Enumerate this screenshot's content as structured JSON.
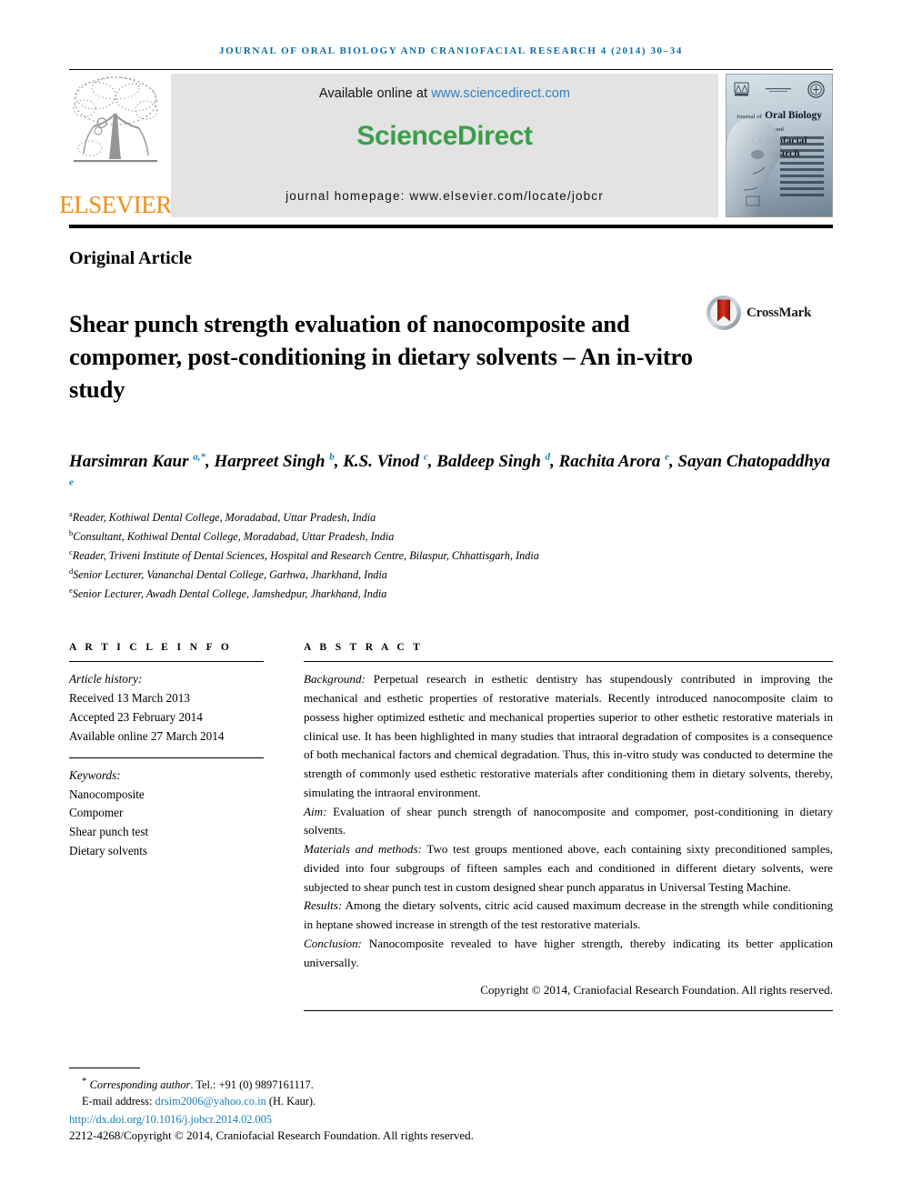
{
  "running_head": "JOURNAL OF ORAL BIOLOGY AND CRANIOFACIAL RESEARCH 4 (2014) 30–34",
  "masthead": {
    "publisher_name": "ELSEVIER",
    "available_prefix": "Available online at ",
    "available_url": "www.sciencedirect.com",
    "brand": "ScienceDirect",
    "homepage": "journal homepage: www.elsevier.com/locate/jobcr",
    "cover": {
      "title_prefix": "Journal of",
      "title_line1": "Oral Biology",
      "title_and": "and",
      "title_line2": "Craniofacial Research"
    }
  },
  "article_type": "Original Article",
  "title": "Shear punch strength evaluation of nanocomposite and compomer, post-conditioning in dietary solvents – An in-vitro study",
  "crossmark_label": "CrossMark",
  "authors_html": "Harsimran Kaur <sup>a,*</sup>, Harpreet Singh <sup>b</sup>, K.S. Vinod <sup>c</sup>, Baldeep Singh <sup>d</sup>, Rachita Arora <sup>e</sup>, Sayan Chatopaddhya <sup>e</sup>",
  "affiliations": [
    {
      "marker": "a",
      "text": "Reader, Kothiwal Dental College, Moradabad, Uttar Pradesh, India"
    },
    {
      "marker": "b",
      "text": "Consultant, Kothiwal Dental College, Moradabad, Uttar Pradesh, India"
    },
    {
      "marker": "c",
      "text": "Reader, Triveni Institute of Dental Sciences, Hospital and Research Centre, Bilaspur, Chhattisgarh, India"
    },
    {
      "marker": "d",
      "text": "Senior Lecturer, Vananchal Dental College, Garhwa, Jharkhand, India"
    },
    {
      "marker": "e",
      "text": "Senior Lecturer, Awadh Dental College, Jamshedpur, Jharkhand, India"
    }
  ],
  "article_info": {
    "heading": "A R T I C L E   I N F O",
    "history_label": "Article history:",
    "received": "Received 13 March 2013",
    "accepted": "Accepted 23 February 2014",
    "available_online": "Available online 27 March 2014",
    "keywords_label": "Keywords:",
    "keywords": [
      "Nanocomposite",
      "Compomer",
      "Shear punch test",
      "Dietary solvents"
    ]
  },
  "abstract": {
    "heading": "A B S T R A C T",
    "sections": [
      {
        "label": "Background:",
        "text": " Perpetual research in esthetic dentistry has stupendously contributed in improving the mechanical and esthetic properties of restorative materials. Recently introduced nanocomposite claim to possess higher optimized esthetic and mechanical properties superior to other esthetic restorative materials in clinical use. It has been highlighted in many studies that intraoral degradation of composites is a consequence of both mechanical factors and chemical degradation. Thus, this in-vitro study was conducted to determine the strength of commonly used esthetic restorative materials after conditioning them in dietary solvents, thereby, simulating the intraoral environment."
      },
      {
        "label": "Aim:",
        "text": " Evaluation of shear punch strength of nanocomposite and compomer, post-conditioning in dietary solvents."
      },
      {
        "label": "Materials and methods:",
        "text": " Two test groups mentioned above, each containing sixty preconditioned samples, divided into four subgroups of fifteen samples each and conditioned in different dietary solvents, were subjected to shear punch test in custom designed shear punch apparatus in Universal Testing Machine."
      },
      {
        "label": "Results:",
        "text": " Among the dietary solvents, citric acid caused maximum decrease in the strength while conditioning in heptane showed increase in strength of the test restorative materials."
      },
      {
        "label": "Conclusion:",
        "text": " Nanocomposite revealed to have higher strength, thereby indicating its better application universally."
      }
    ],
    "copyright": "Copyright © 2014, Craniofacial Research Foundation. All rights reserved."
  },
  "footnotes": {
    "corresponding_label": "Corresponding author",
    "corresponding_rest": ". Tel.: +91 (0) 9897161117.",
    "email_label": "E-mail address: ",
    "email": "drsim2006@yahoo.co.in",
    "email_suffix": " (H. Kaur).",
    "doi": "http://dx.doi.org/10.1016/j.jobcr.2014.02.005",
    "issn_copyright": "2212-4268/Copyright © 2014, Craniofacial Research Foundation. All rights reserved."
  },
  "colors": {
    "running_head_blue": "#0a6ea6",
    "link_blue": "#1b7fb5",
    "sciencedirect_green": "#3a9e4a",
    "elsevier_orange": "#f08d1d",
    "sd_box_gray": "#e3e3e3"
  }
}
